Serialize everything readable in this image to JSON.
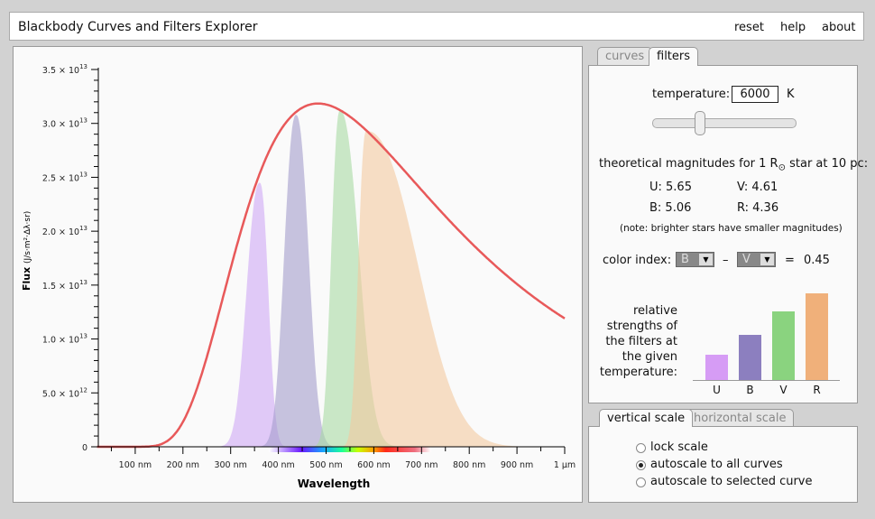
{
  "header": {
    "title": "Blackbody Curves and Filters Explorer",
    "menu": [
      "reset",
      "help",
      "about"
    ]
  },
  "tabs_top": [
    "curves",
    "filters"
  ],
  "tabs_bottom": [
    "vertical scale",
    "horizontal scale"
  ],
  "filters_panel": {
    "temperature_label": "temperature:",
    "temperature_value": "6000",
    "temperature_unit": "K",
    "slider_fraction": 0.33,
    "magnitudes_title_pre": "theoretical magnitudes for 1 R",
    "magnitudes_title_sub": "⊙",
    "magnitudes_title_post": " star at 10 pc:",
    "mags": {
      "U": "U:  5.65",
      "V": "V:  4.61",
      "B": "B:  5.06",
      "R": "R:  4.36"
    },
    "note": "(note: brighter stars have smaller magnitudes)",
    "color_index_label": "color index:",
    "ci_first": "B",
    "ci_minus": "–",
    "ci_second": "V",
    "ci_equals": "=",
    "ci_value": "0.45",
    "strengths_label": [
      "relative",
      "strengths of",
      "the filters at",
      "the given",
      "temperature:"
    ],
    "bars": [
      {
        "label": "U",
        "value": 0.29,
        "color": "#d69cf5"
      },
      {
        "label": "B",
        "value": 0.52,
        "color": "#8c7fbf"
      },
      {
        "label": "V",
        "value": 0.79,
        "color": "#8ad37f"
      },
      {
        "label": "R",
        "value": 1.0,
        "color": "#f0b07a"
      }
    ]
  },
  "scale_panel": {
    "options": [
      "lock scale",
      "autoscale to all curves",
      "autoscale to selected curve"
    ],
    "selected": 1
  },
  "chart_data": {
    "type": "line",
    "xlabel": "Wavelength",
    "ylabel": "Flux",
    "ylabel_units": "(J/s·m²·Δλ·sr)",
    "xlim": [
      20,
      1000
    ],
    "ylim": [
      0,
      35000000000000.0
    ],
    "x_ticks": [
      {
        "v": 100,
        "l": "100 nm"
      },
      {
        "v": 200,
        "l": "200 nm"
      },
      {
        "v": 300,
        "l": "300 nm"
      },
      {
        "v": 400,
        "l": "400 nm"
      },
      {
        "v": 500,
        "l": "500 nm"
      },
      {
        "v": 600,
        "l": "600 nm"
      },
      {
        "v": 700,
        "l": "700 nm"
      },
      {
        "v": 800,
        "l": "800 nm"
      },
      {
        "v": 900,
        "l": "900 nm"
      },
      {
        "v": 1000,
        "l": "1 μm"
      }
    ],
    "y_ticks": [
      {
        "v": 0,
        "m": "0",
        "e": ""
      },
      {
        "v": 5000000000000.0,
        "m": "5.0 × 10",
        "e": "12"
      },
      {
        "v": 10000000000000.0,
        "m": "1.0 × 10",
        "e": "13"
      },
      {
        "v": 15000000000000.0,
        "m": "1.5 × 10",
        "e": "13"
      },
      {
        "v": 20000000000000.0,
        "m": "2.0 × 10",
        "e": "13"
      },
      {
        "v": 25000000000000.0,
        "m": "2.5 × 10",
        "e": "13"
      },
      {
        "v": 30000000000000.0,
        "m": "3.0 × 10",
        "e": "13"
      },
      {
        "v": 35000000000000.0,
        "m": "3.5 × 10",
        "e": "13"
      }
    ],
    "blackbody": {
      "temperature_K": 6000,
      "color": "#e8595a"
    },
    "filter_curves": [
      {
        "name": "U",
        "peak_nm": 361,
        "peak_flux": 24500000000000.0,
        "color": "#cfa8f5"
      },
      {
        "name": "B",
        "peak_nm": 437,
        "peak_flux": 30800000000000.0,
        "color": "#a49ccb"
      },
      {
        "name": "V",
        "peak_nm": 529,
        "peak_flux": 31200000000000.0,
        "color": "#a9daa4"
      },
      {
        "name": "R",
        "peak_nm": 584,
        "peak_flux": 29300000000000.0,
        "color": "#f4c9a0"
      }
    ]
  }
}
